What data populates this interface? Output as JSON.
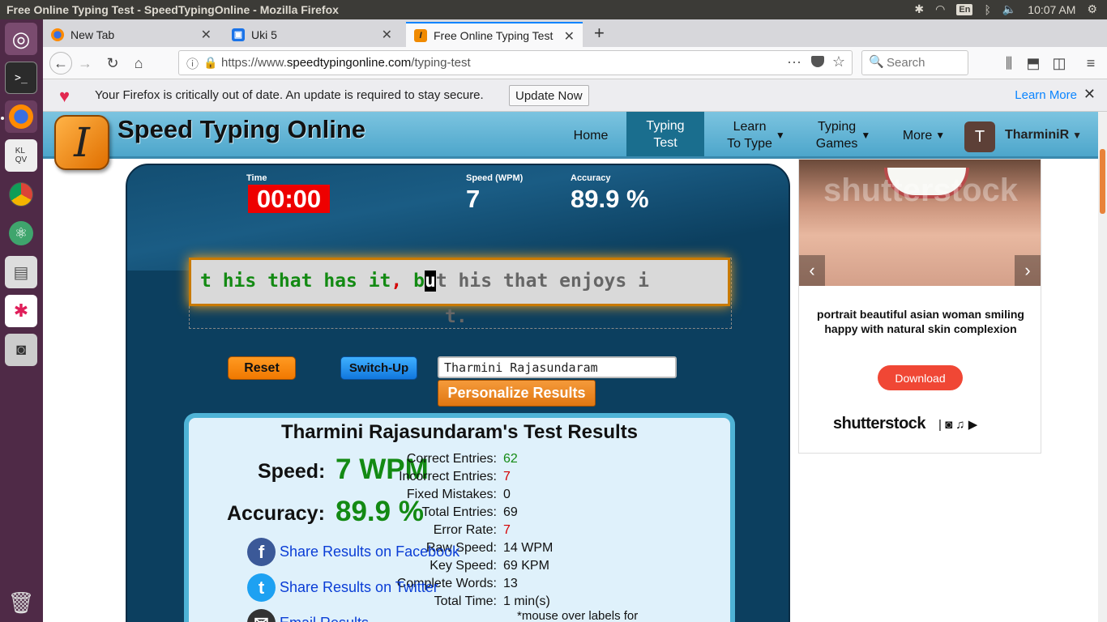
{
  "os": {
    "window_title": "Free Online Typing Test - SpeedTypingOnline - Mozilla Firefox",
    "keyboard_layout": "En",
    "clock": "10:07 AM"
  },
  "browser": {
    "tabs": [
      {
        "label": "New Tab"
      },
      {
        "label": "Uki 5"
      },
      {
        "label": "Free Online Typing Test"
      }
    ],
    "url_prefix": "https://www.",
    "url_domain": "speedtypingonline.com",
    "url_path": "/typing-test",
    "search_placeholder": "Search",
    "notification": {
      "message": "Your Firefox is critically out of date. An update is required to stay secure.",
      "update_button": "Update Now",
      "learn_more": "Learn More"
    }
  },
  "site": {
    "name": "Speed Typing Online",
    "logo_letter": "I",
    "nav": {
      "home": "Home",
      "typing_test_1": "Typing",
      "typing_test_2": "Test",
      "learn_1": "Learn",
      "learn_2": "To Type",
      "games_1": "Typing",
      "games_2": "Games",
      "more": "More"
    },
    "user": {
      "initial": "T",
      "name": "TharminiR"
    }
  },
  "test": {
    "time_label": "Time",
    "time_value": "00:00",
    "speed_label": "Speed (WPM)",
    "speed_value": "7",
    "accuracy_label": "Accuracy",
    "accuracy_value": "89.9 %",
    "text_done": "t his that has it",
    "text_error": ",",
    "text_done2": " b",
    "text_cursor": "u",
    "text_rest": "t his that enjoys i",
    "text_wrap": "t.",
    "reset_label": "Reset",
    "switch_label": "Switch-Up",
    "name_value": "Tharmini Rajasundaram",
    "personalize_label": "Personalize Results"
  },
  "results": {
    "title": "Tharmini Rajasundaram's Test Results",
    "speed_label": "Speed:",
    "speed_value": "7 WPM",
    "accuracy_label": "Accuracy:",
    "accuracy_value": "89.9 %",
    "stats": [
      {
        "label": "Correct Entries:",
        "value": "62"
      },
      {
        "label": "Incorrect Entries:",
        "value": "7"
      },
      {
        "label": "Fixed Mistakes:",
        "value": "0"
      },
      {
        "label": "Total Entries:",
        "value": "69"
      },
      {
        "label": "Error Rate:",
        "value": "7"
      },
      {
        "label": "Raw Speed:",
        "value": "14 WPM"
      },
      {
        "label": "Key Speed:",
        "value": "69 KPM"
      },
      {
        "label": "Complete Words:",
        "value": "13"
      },
      {
        "label": "Total Time:",
        "value": "1 min(s)"
      }
    ],
    "share_facebook": "Share Results on Facebook",
    "share_twitter": "Share Results on Twitter",
    "share_email": "Email Results",
    "note": "*mouse over labels for"
  },
  "ad": {
    "watermark": "shutterstock",
    "description": "portrait beautiful asian woman smiling happy with natural skin complexion",
    "download_label": "Download",
    "brand": "shutterstock"
  }
}
